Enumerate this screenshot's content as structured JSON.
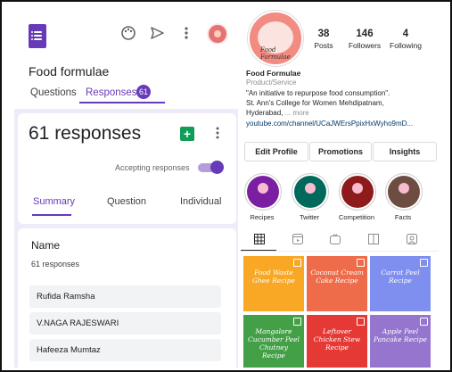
{
  "forms": {
    "form_title": "Food formulae",
    "tabs": [
      "Questions",
      "Responses"
    ],
    "responses_badge": "61",
    "responses_heading": "61 responses",
    "accepting_label": "Accepting responses",
    "accepting_on": true,
    "subtabs": [
      "Summary",
      "Question",
      "Individual"
    ],
    "question_title": "Name",
    "question_sub": "61 responses",
    "names": [
      "Rufida Ramsha",
      "V.NAGA RAJESWARI",
      "Hafeeza Mumtaz"
    ],
    "accent": "#673ab7",
    "icons": [
      "forms-logo-icon",
      "palette-icon",
      "send-icon",
      "more-vert-icon",
      "sheets-icon"
    ]
  },
  "instagram": {
    "avatar_text": "Food Formulae",
    "stats": [
      {
        "num": "38",
        "label": "Posts"
      },
      {
        "num": "146",
        "label": "Followers"
      },
      {
        "num": "4",
        "label": "Following"
      }
    ],
    "name": "Food Formulae",
    "category": "Product/Service",
    "bio_lines": [
      "\"An initiative to repurpose food consumption\".",
      "St. Ann's College for Women Mehdipatnam,",
      "Hyderabad,"
    ],
    "more": "... more",
    "link": "youtube.com/channel/UCaJWErsPpixHxWyho9mD...",
    "buttons": [
      "Edit Profile",
      "Promotions",
      "Insights"
    ],
    "highlights": [
      {
        "label": "Recipes",
        "color": "#7b1fa2"
      },
      {
        "label": "Twitter",
        "color": "#00695c"
      },
      {
        "label": "Competition",
        "color": "#8e1b1b"
      },
      {
        "label": "Facts",
        "color": "#6d4c41"
      }
    ],
    "profile_tabs": [
      "grid-icon",
      "reels-icon",
      "igtv-icon",
      "guides-icon",
      "tagged-icon"
    ],
    "posts": [
      {
        "title": "Food Waste Ghee Recipe",
        "color": "#f9a825"
      },
      {
        "title": "Coconut Cream Cake Recipe",
        "color": "#ef6c4a"
      },
      {
        "title": "Carrot Peel Recipe",
        "color": "#7e8ff0"
      },
      {
        "title": "Mangalore Cucumber Peel Chutney Recipe",
        "color": "#43a047"
      },
      {
        "title": "Leftover Chicken Stew Recipe",
        "color": "#e53935"
      },
      {
        "title": "Apple Peel Pancake Recipe",
        "color": "#9575cd"
      }
    ]
  }
}
